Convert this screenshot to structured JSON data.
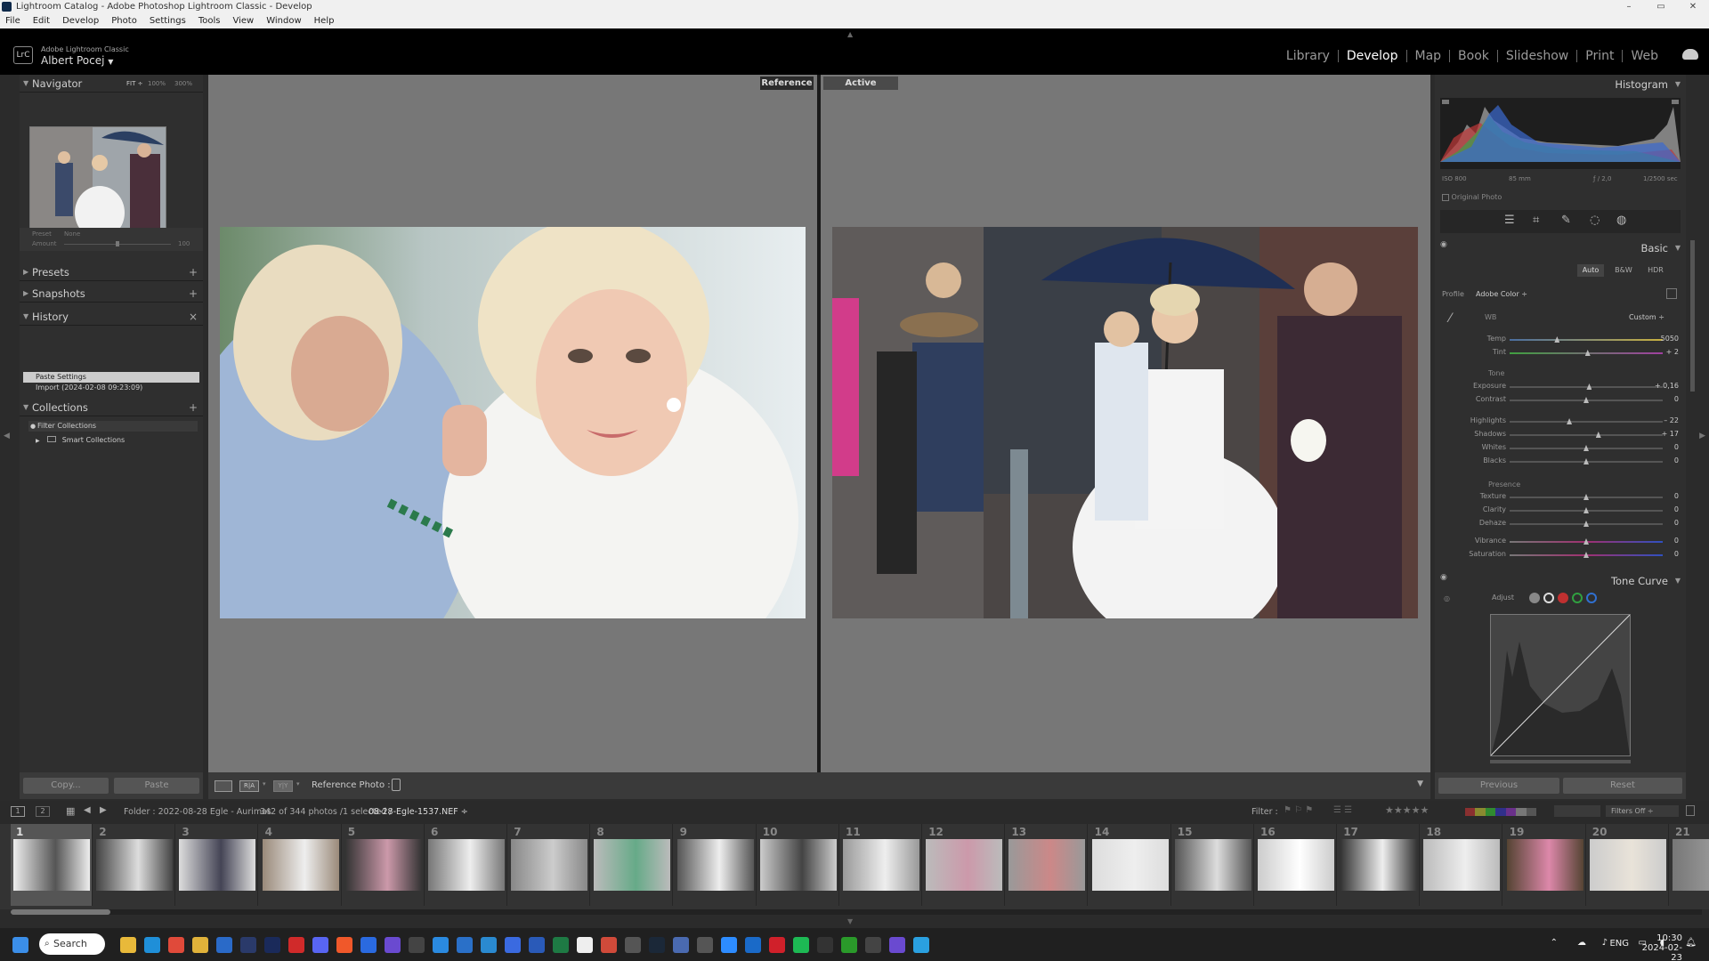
{
  "window": {
    "title": "Lightroom Catalog - Adobe Photoshop Lightroom Classic - Develop",
    "controls": [
      "–",
      "▭",
      "✕"
    ]
  },
  "menu": [
    "File",
    "Edit",
    "Develop",
    "Photo",
    "Settings",
    "Tools",
    "View",
    "Window",
    "Help"
  ],
  "identity": {
    "logo": "LrC",
    "product": "Adobe Lightroom Classic",
    "user": "Albert Pocej",
    "user_arrow": "▼"
  },
  "modules": [
    {
      "label": "Library",
      "active": false
    },
    {
      "label": "Develop",
      "active": true
    },
    {
      "label": "Map",
      "active": false
    },
    {
      "label": "Book",
      "active": false
    },
    {
      "label": "Slideshow",
      "active": false
    },
    {
      "label": "Print",
      "active": false
    },
    {
      "label": "Web",
      "active": false
    }
  ],
  "left": {
    "navigator": {
      "title": "Navigator",
      "zoom": [
        "FIT ÷",
        "100%",
        "300%"
      ]
    },
    "preset_row": {
      "preset_label": "Preset",
      "preset_value": "None",
      "amount_label": "Amount",
      "amount_value": "100"
    },
    "presets": "Presets",
    "snapshots": "Snapshots",
    "history": {
      "title": "History",
      "items": [
        "Paste Settings",
        "Import (2024-02-08 09:23:09)"
      ]
    },
    "collections": {
      "title": "Collections",
      "items": [
        "Filter Collections",
        "Smart Collections"
      ]
    },
    "copy": "Copy...",
    "paste": "Paste"
  },
  "main": {
    "reference_label": "Reference",
    "active_label": "Active",
    "toolbar_label": "Reference Photo :"
  },
  "right": {
    "histogram_title": "Histogram",
    "exif": [
      "ISO 800",
      "85 mm",
      "ƒ / 2,0",
      "1/2500 sec"
    ],
    "original_photo": "Original Photo",
    "basic_title": "Basic",
    "treatment": [
      "Auto",
      "B&W",
      "HDR"
    ],
    "profile_label": "Profile",
    "profile_value": "Adobe Color ÷",
    "wb_label": "WB",
    "wb_value": "Custom ÷",
    "tone_label": "Tone",
    "presence_label": "Presence",
    "sliders": [
      {
        "label": "Temp",
        "value": "5050",
        "pos": 0.31
      },
      {
        "label": "Tint",
        "value": "+ 2",
        "pos": 0.51
      },
      {
        "label": "Exposure",
        "value": "+ 0,16",
        "pos": 0.52
      },
      {
        "label": "Contrast",
        "value": "0",
        "pos": 0.5
      },
      {
        "label": "Highlights",
        "value": "– 22",
        "pos": 0.39
      },
      {
        "label": "Shadows",
        "value": "+ 17",
        "pos": 0.58
      },
      {
        "label": "Whites",
        "value": "0",
        "pos": 0.5
      },
      {
        "label": "Blacks",
        "value": "0",
        "pos": 0.5
      },
      {
        "label": "Texture",
        "value": "0",
        "pos": 0.5
      },
      {
        "label": "Clarity",
        "value": "0",
        "pos": 0.5
      },
      {
        "label": "Dehaze",
        "value": "0",
        "pos": 0.5
      },
      {
        "label": "Vibrance",
        "value": "0",
        "pos": 0.5
      },
      {
        "label": "Saturation",
        "value": "0",
        "pos": 0.5
      }
    ],
    "tone_curve_title": "Tone Curve",
    "adjust_label": "Adjust",
    "previous": "Previous",
    "reset": "Reset"
  },
  "filmstrip": {
    "pages": [
      "1",
      "2"
    ],
    "folder": "Folder : 2022-08-28 Egle - Aurimas",
    "count": "342 of 344 photos /1 selected /",
    "filename": "08-28-Egle-1537.NEF ÷",
    "filter_label": "Filter :",
    "filters_off": "Filters Off ÷",
    "numbers": [
      "1",
      "2",
      "3",
      "4",
      "5",
      "6",
      "7",
      "8",
      "9",
      "10",
      "11",
      "12",
      "13",
      "14",
      "15",
      "16",
      "17",
      "18",
      "19",
      "20",
      "21"
    ]
  },
  "taskbar": {
    "search": "Search",
    "lang": "ENG",
    "time": "10:30",
    "date": "2024-02-23"
  }
}
